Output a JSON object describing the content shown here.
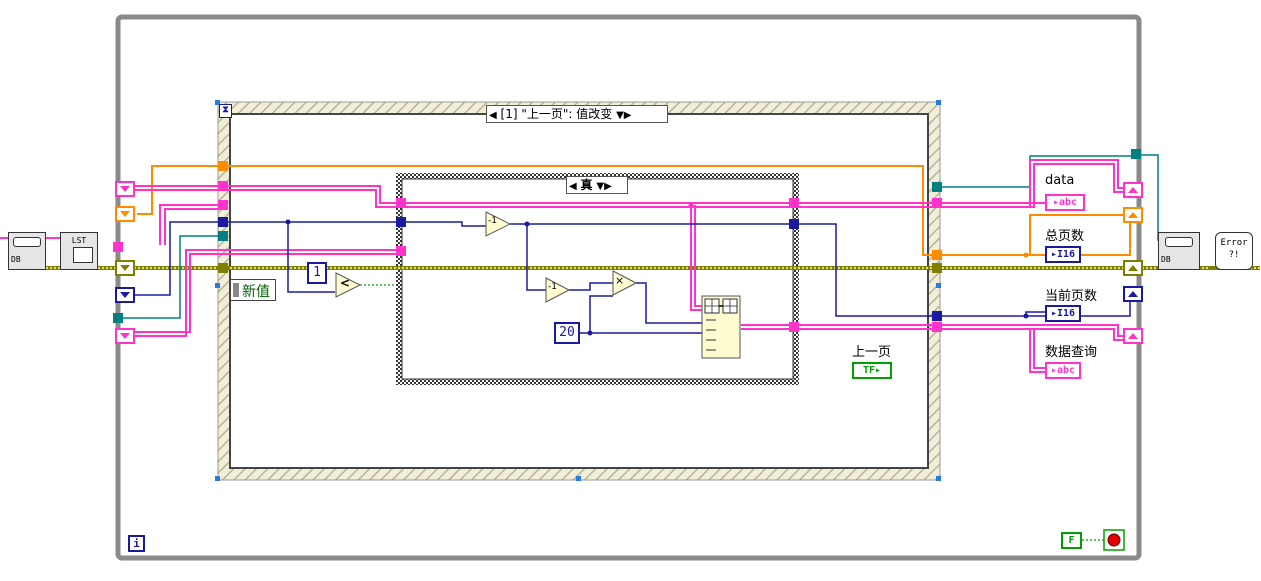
{
  "event_structure": {
    "selector_label": "[1] \"上一页\": 值改变",
    "newval_label": "新值"
  },
  "case_structure": {
    "selector_label": "真"
  },
  "constants": {
    "one": "1",
    "twenty": "20",
    "false_const": "F"
  },
  "functions": {
    "decrement_a": "-1",
    "decrement_b": "-1",
    "multiply": "×",
    "less_than": "<"
  },
  "indicators": {
    "data": {
      "label": "data",
      "type": "abc"
    },
    "total_pages": {
      "label": "总页数",
      "type": "I16"
    },
    "current_page": {
      "label": "当前页数",
      "type": "I16"
    },
    "data_query": {
      "label": "数据查询",
      "type": "abc"
    }
  },
  "button": {
    "label": "上一页",
    "type": "TF"
  },
  "subvis": {
    "db_open": "DB",
    "db_list": "LST",
    "db_close": "DB",
    "error_handler": "Error ?!"
  },
  "loop": {
    "iteration": "i"
  },
  "colors": {
    "string_wire": "#ff33cc",
    "int_wire": "#1a1aa0",
    "refnum_wire": "#ff8c00",
    "error_wire": "#808000",
    "cluster_wire": "#008080",
    "frame_gray": "#808080",
    "bool_wire": "#00a000"
  }
}
